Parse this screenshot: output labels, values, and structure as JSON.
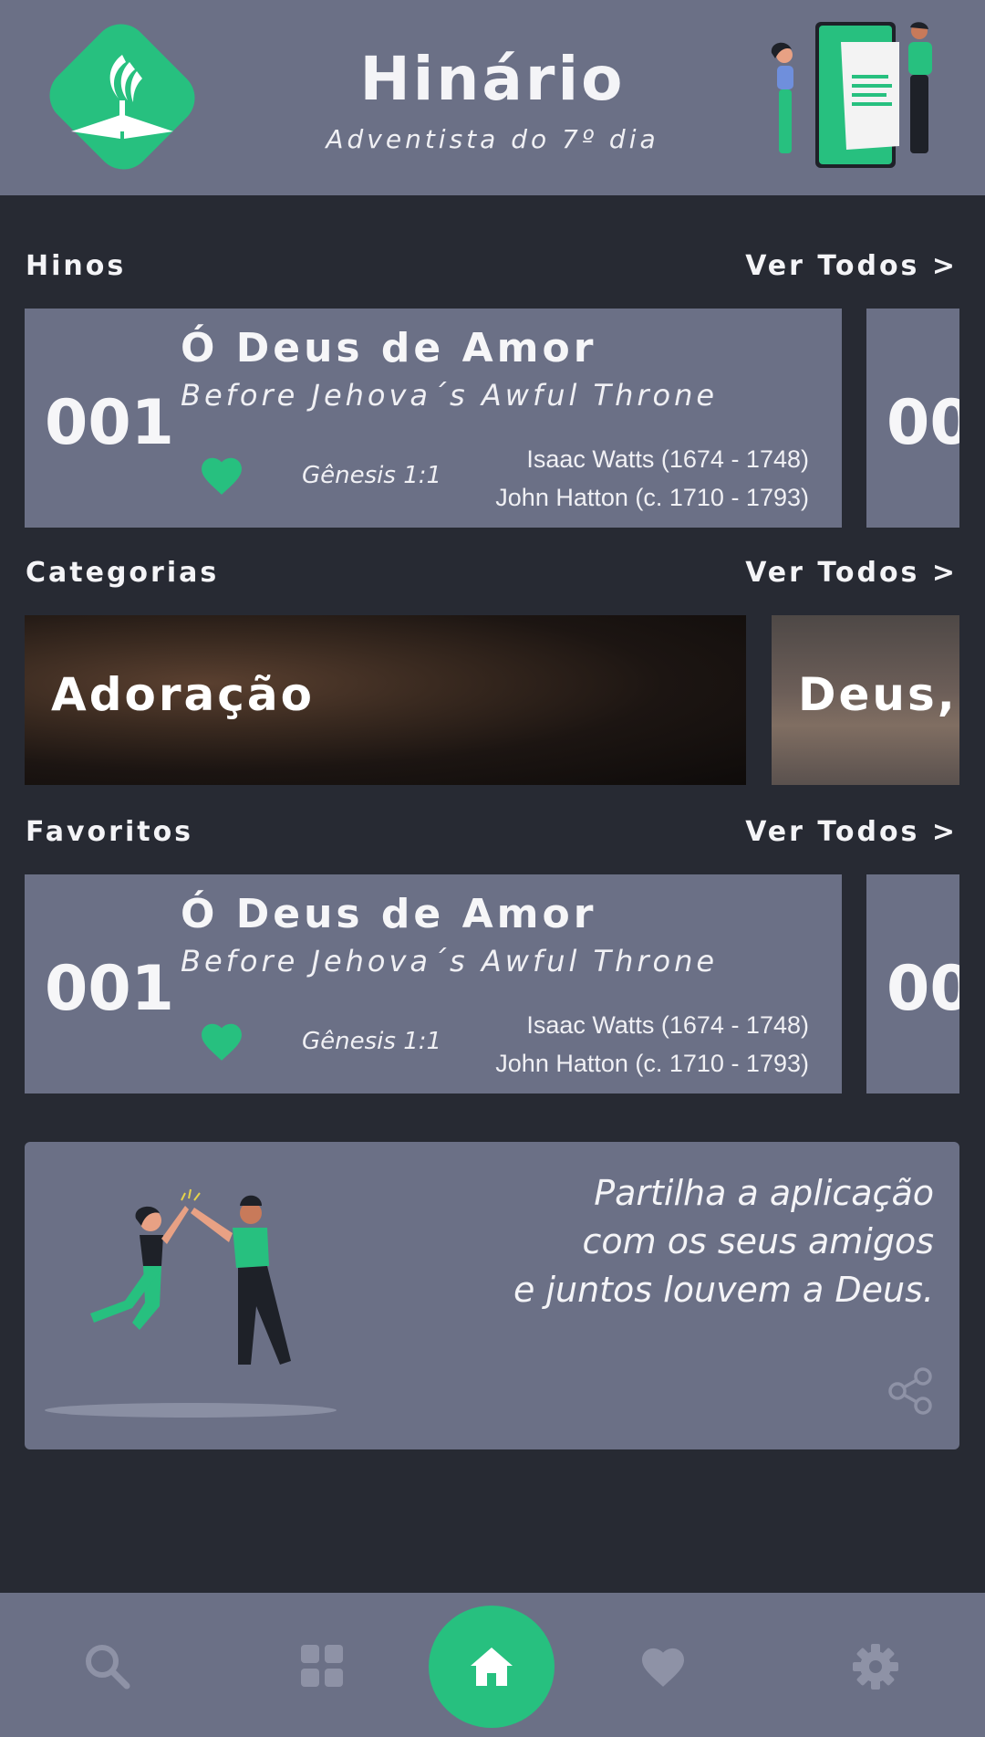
{
  "header": {
    "title": "Hinário",
    "subtitle": "Adventista do 7º dia"
  },
  "sections": {
    "hymns": {
      "title": "Hinos",
      "see_all": "Ver Todos >"
    },
    "categories": {
      "title": "Categorias",
      "see_all": "Ver Todos >"
    },
    "favorites": {
      "title": "Favoritos",
      "see_all": "Ver Todos >"
    }
  },
  "hymns": [
    {
      "number": "001",
      "title": "Ó Deus de Amor",
      "original_title": "Before Jehova´s Awful Throne",
      "reference": "Gênesis 1:1",
      "author_1": "Isaac Watts (1674 - 1748)",
      "author_2": "John Hatton (c. 1710 - 1793)"
    }
  ],
  "hymns_peek": {
    "number": "00"
  },
  "categories": [
    {
      "label": "Adoração"
    },
    {
      "label": "Deus, "
    }
  ],
  "favorites": [
    {
      "number": "001",
      "title": "Ó Deus de Amor",
      "original_title": "Before Jehova´s Awful Throne",
      "reference": "Gênesis 1:1",
      "author_1": "Isaac Watts (1674 - 1748)",
      "author_2": "John Hatton (c. 1710 - 1793)"
    }
  ],
  "favorites_peek": {
    "number": "00"
  },
  "share": {
    "line_1": "Partilha a aplicação",
    "line_2": "com os seus amigos",
    "line_3": "e juntos louvem a Deus."
  },
  "nav": {
    "items": [
      "search-icon",
      "grid-icon",
      "home-icon",
      "heart-icon",
      "gear-icon"
    ],
    "active": "home-icon"
  },
  "colors": {
    "accent": "#27c07f",
    "card": "#6b7086",
    "background": "#272a33",
    "icon_muted": "#8e92a6"
  }
}
